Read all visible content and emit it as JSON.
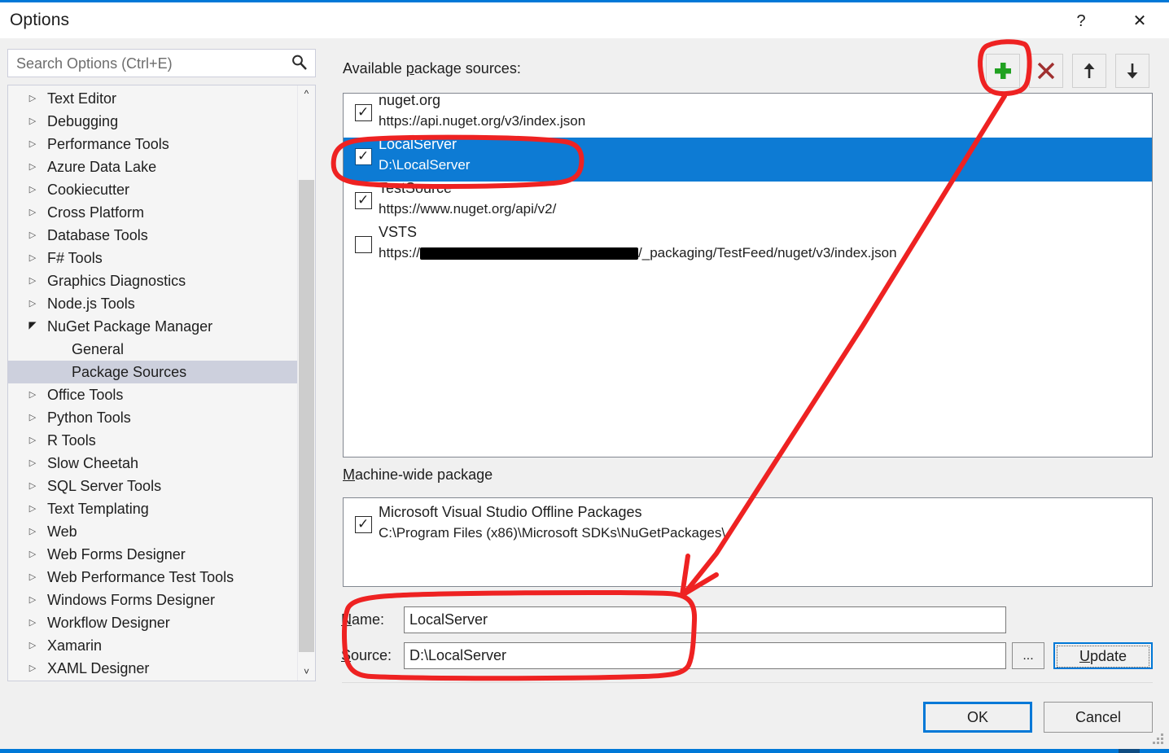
{
  "window": {
    "title": "Options",
    "help_button": "?",
    "close_button": "✕"
  },
  "search": {
    "placeholder": "Search Options (Ctrl+E)",
    "value": "",
    "icon": "search-icon"
  },
  "tree": {
    "items": [
      {
        "label": "Text Editor",
        "expandable": true,
        "expanded": false,
        "level": 0,
        "selected": false
      },
      {
        "label": "Debugging",
        "expandable": true,
        "expanded": false,
        "level": 0,
        "selected": false
      },
      {
        "label": "Performance Tools",
        "expandable": true,
        "expanded": false,
        "level": 0,
        "selected": false
      },
      {
        "label": "Azure Data Lake",
        "expandable": true,
        "expanded": false,
        "level": 0,
        "selected": false
      },
      {
        "label": "Cookiecutter",
        "expandable": true,
        "expanded": false,
        "level": 0,
        "selected": false
      },
      {
        "label": "Cross Platform",
        "expandable": true,
        "expanded": false,
        "level": 0,
        "selected": false
      },
      {
        "label": "Database Tools",
        "expandable": true,
        "expanded": false,
        "level": 0,
        "selected": false
      },
      {
        "label": "F# Tools",
        "expandable": true,
        "expanded": false,
        "level": 0,
        "selected": false
      },
      {
        "label": "Graphics Diagnostics",
        "expandable": true,
        "expanded": false,
        "level": 0,
        "selected": false
      },
      {
        "label": "Node.js Tools",
        "expandable": true,
        "expanded": false,
        "level": 0,
        "selected": false
      },
      {
        "label": "NuGet Package Manager",
        "expandable": true,
        "expanded": true,
        "level": 0,
        "selected": false
      },
      {
        "label": "General",
        "expandable": false,
        "expanded": false,
        "level": 1,
        "selected": false
      },
      {
        "label": "Package Sources",
        "expandable": false,
        "expanded": false,
        "level": 1,
        "selected": true
      },
      {
        "label": "Office Tools",
        "expandable": true,
        "expanded": false,
        "level": 0,
        "selected": false
      },
      {
        "label": "Python Tools",
        "expandable": true,
        "expanded": false,
        "level": 0,
        "selected": false
      },
      {
        "label": "R Tools",
        "expandable": true,
        "expanded": false,
        "level": 0,
        "selected": false
      },
      {
        "label": "Slow Cheetah",
        "expandable": true,
        "expanded": false,
        "level": 0,
        "selected": false
      },
      {
        "label": "SQL Server Tools",
        "expandable": true,
        "expanded": false,
        "level": 0,
        "selected": false
      },
      {
        "label": "Text Templating",
        "expandable": true,
        "expanded": false,
        "level": 0,
        "selected": false
      },
      {
        "label": "Web",
        "expandable": true,
        "expanded": false,
        "level": 0,
        "selected": false
      },
      {
        "label": "Web Forms Designer",
        "expandable": true,
        "expanded": false,
        "level": 0,
        "selected": false
      },
      {
        "label": "Web Performance Test Tools",
        "expandable": true,
        "expanded": false,
        "level": 0,
        "selected": false
      },
      {
        "label": "Windows Forms Designer",
        "expandable": true,
        "expanded": false,
        "level": 0,
        "selected": false
      },
      {
        "label": "Workflow Designer",
        "expandable": true,
        "expanded": false,
        "level": 0,
        "selected": false
      },
      {
        "label": "Xamarin",
        "expandable": true,
        "expanded": false,
        "level": 0,
        "selected": false
      },
      {
        "label": "XAML Designer",
        "expandable": true,
        "expanded": false,
        "level": 0,
        "selected": false
      }
    ],
    "scroll_up_icon": "chevron-up-icon",
    "scroll_down_icon": "chevron-down-icon"
  },
  "panel": {
    "available_label_prefix": "Available ",
    "available_label_accel": "p",
    "available_label_suffix": "ackage sources:",
    "machine_label_accel": "M",
    "machine_label_suffix": "achine-wide package"
  },
  "toolbar": {
    "add": {
      "name": "add-source-button",
      "icon": "plus-icon",
      "color": "#21a121"
    },
    "remove": {
      "name": "remove-source-button",
      "icon": "close-x-icon",
      "color": "#a03030"
    },
    "move_up": {
      "name": "move-up-button",
      "icon": "arrow-up-icon",
      "color": "#2b2b2b"
    },
    "move_down": {
      "name": "move-down-button",
      "icon": "arrow-down-icon",
      "color": "#2b2b2b"
    }
  },
  "sources": [
    {
      "name": "nuget.org",
      "url": "https://api.nuget.org/v3/index.json",
      "checked": true,
      "selected": false
    },
    {
      "name": "LocalServer",
      "url": "D:\\LocalServer",
      "checked": true,
      "selected": true
    },
    {
      "name": "TestSource",
      "url": "https://www.nuget.org/api/v2/",
      "checked": true,
      "selected": false
    },
    {
      "name": "VSTS",
      "url_prefix": "https://",
      "url_redacted": true,
      "url_suffix": "/_packaging/TestFeed/nuget/v3/index.json",
      "checked": false,
      "selected": false
    }
  ],
  "machine_wide": [
    {
      "name": "Microsoft Visual Studio Offline Packages",
      "url": "C:\\Program Files (x86)\\Microsoft SDKs\\NuGetPackages\\",
      "checked": true
    }
  ],
  "form": {
    "name_label_accel": "N",
    "name_label_suffix": "ame:",
    "name_value": "LocalServer",
    "source_label_accel": "S",
    "source_label_suffix": "ource:",
    "source_value": "D:\\LocalServer",
    "browse_label": "...",
    "update_label_accel": "U",
    "update_label_suffix": "pdate"
  },
  "footer": {
    "ok_label": "OK",
    "cancel_label": "Cancel"
  },
  "annotations": {
    "accent_color": "#ee2222",
    "highlight_add_button": true,
    "highlight_selected_source": true,
    "highlight_name_source_fields": true,
    "arrow_from_add_to_fields": true
  }
}
